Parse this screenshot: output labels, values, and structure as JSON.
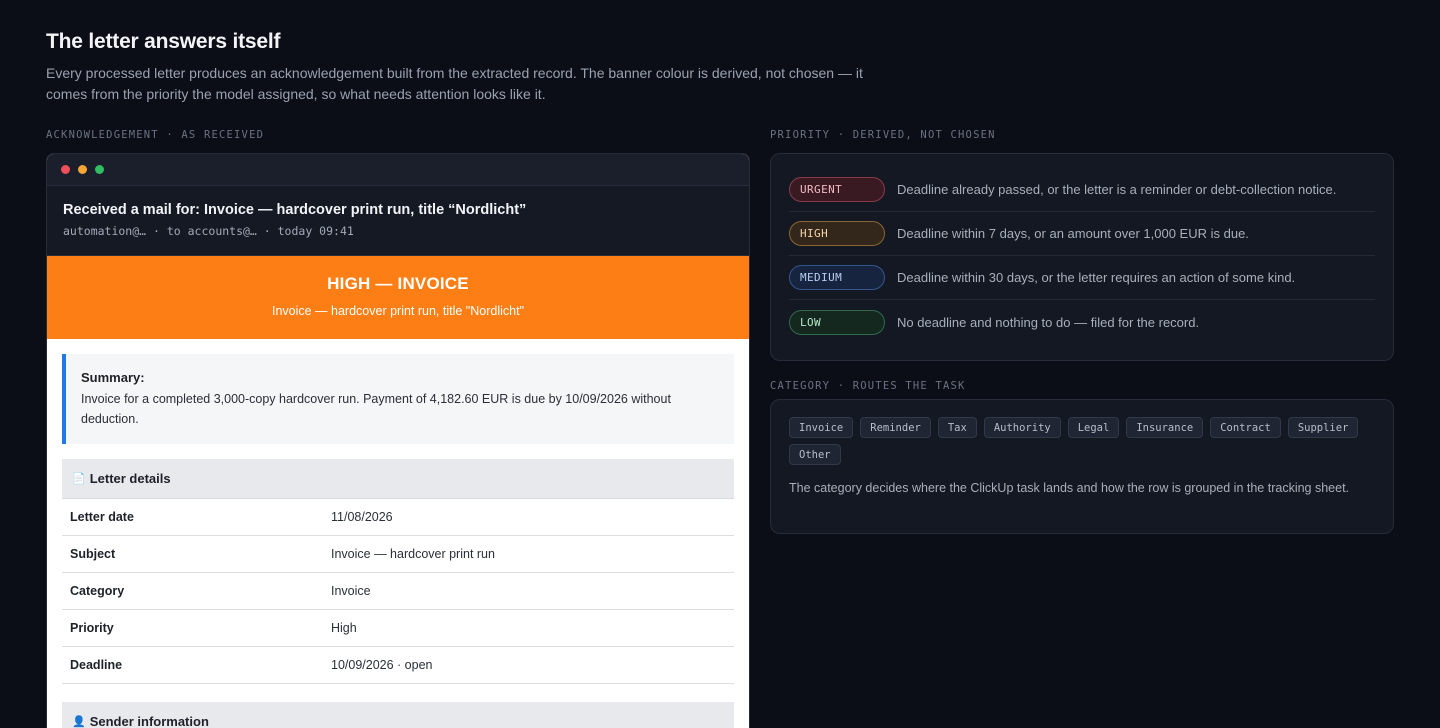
{
  "header": {
    "title": "The letter answers itself",
    "description": "Every processed letter produces an acknowledgement built from the extracted record. The banner colour is derived, not chosen — it comes from the priority the model assigned, so what needs attention looks like it."
  },
  "labels": {
    "acknowledgement": "ACKNOWLEDGEMENT · AS RECEIVED",
    "priority": "PRIORITY · DERIVED, NOT CHOSEN",
    "category": "CATEGORY · ROUTES THE TASK"
  },
  "mail": {
    "subject": "Received a mail for: Invoice — hardcover print run, title “Nordlicht”",
    "meta": "automation@… · to accounts@… · today 09:41",
    "banner_color": "#fc7e14",
    "banner_title": "HIGH — INVOICE",
    "banner_subtitle": "Invoice — hardcover print run, title \"Nordlicht\"",
    "summary_label": "Summary:",
    "summary_text": "Invoice for a completed 3,000-copy hardcover run. Payment of 4,182.60 EUR is due by 10/09/2026 without deduction.",
    "details_heading": "Letter details",
    "details_icon": "document-icon",
    "details": [
      {
        "key": "Letter date",
        "value": "11/08/2026"
      },
      {
        "key": "Subject",
        "value": "Invoice — hardcover print run"
      },
      {
        "key": "Category",
        "value": "Invoice"
      },
      {
        "key": "Priority",
        "value": "High"
      },
      {
        "key": "Deadline",
        "value": "10/09/2026 · open"
      }
    ],
    "sender_heading": "Sender information",
    "sender_icon": "person-icon"
  },
  "priorities": [
    {
      "label": "URGENT",
      "description": "Deadline already passed, or the letter is a reminder or debt-collection notice.",
      "color": "#8a3a48"
    },
    {
      "label": "HIGH",
      "description": "Deadline within 7 days, or an amount over 1,000 EUR is due.",
      "color": "#8a6632"
    },
    {
      "label": "MEDIUM",
      "description": "Deadline within 30 days, or the letter requires an action of some kind.",
      "color": "#35558f"
    },
    {
      "label": "LOW",
      "description": "No deadline and nothing to do — filed for the record.",
      "color": "#2f6b4a"
    }
  ],
  "categories": {
    "tags": [
      "Invoice",
      "Reminder",
      "Tax",
      "Authority",
      "Legal",
      "Insurance",
      "Contract",
      "Supplier",
      "Other"
    ],
    "description": "The category decides where the ClickUp task lands and how the row is grouped in the tracking sheet."
  }
}
